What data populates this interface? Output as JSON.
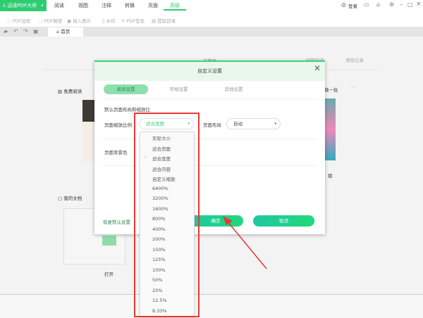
{
  "app": {
    "name": "迅读PDF大师"
  },
  "menu": [
    "阅读",
    "视图",
    "注释",
    "转换",
    "页面",
    "高级"
  ],
  "menu_active": "高级",
  "header_right": {
    "login": "登录"
  },
  "toolbar": [
    "PDF加密",
    "PDF解密",
    "插入图片",
    "水印",
    "PDF签名",
    "提取目录"
  ],
  "tabs": {
    "home": "首页"
  },
  "background": {
    "workbench": "工作台",
    "list": "缩略列表",
    "clear": "清除记录",
    "free_read": "免费阅读",
    "refresh": "换一批",
    "more": "···",
    "my_docs": "我的文档",
    "open": "打开",
    "partial_book": "姐"
  },
  "dialog": {
    "title": "自定义设置",
    "tabs": [
      "阅读设置",
      "常规设置",
      "其他设置"
    ],
    "section_title": "默认页面布局和缩放比",
    "zoom_label": "页面缩放比例",
    "zoom_value": "适合宽度",
    "layout_label": "页面布局",
    "layout_value": "自动",
    "bg_label": "页面背景色",
    "restore": "恢复默认设置",
    "ok": "确定",
    "cancel": "取消"
  },
  "dropdown": {
    "items": [
      "实际大小",
      "适合页面",
      "适合宽度",
      "适合内容",
      "自定义缩放",
      "6400%",
      "3200%",
      "1600%",
      "800%",
      "400%",
      "200%",
      "150%",
      "125%",
      "100%",
      "50%",
      "25%",
      "12.5%",
      "8.33%"
    ],
    "selected": "适合宽度"
  },
  "colors": {
    "accent": "#2ecc71",
    "annotation": "#e53935"
  }
}
